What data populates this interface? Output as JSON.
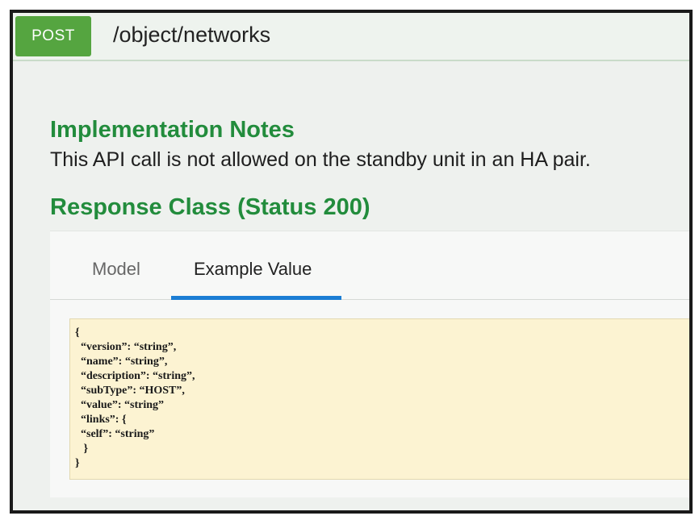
{
  "endpoint": {
    "method": "POST",
    "path": "/object/networks",
    "method_color": "#55a540"
  },
  "implementation_notes": {
    "title": "Implementation Notes",
    "text": "This API call is not allowed on the standby unit in an HA pair."
  },
  "response_class": {
    "title": "Response Class (Status 200)",
    "tabs": [
      {
        "label": "Model",
        "active": false
      },
      {
        "label": "Example Value",
        "active": true
      }
    ],
    "active_tab_color": "#1b7dd4",
    "example_value_lines": [
      "{",
      "  “version”: “string”,",
      "  “name”: “string”,",
      "  “description”: “string”,",
      "  “subType”: “HOST”,",
      "  “value”: “string”",
      "  “links”: {",
      "  “self”: “string”",
      "   }",
      "}"
    ]
  },
  "colors": {
    "heading_green": "#228c3c",
    "code_background": "#fcf3d2"
  }
}
